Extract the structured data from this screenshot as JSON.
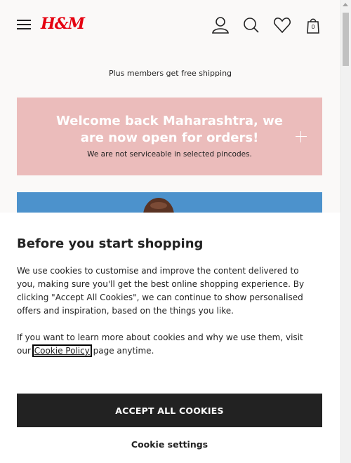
{
  "header": {
    "logo_text": "H&M",
    "cart_count": "0",
    "icons": [
      "menu-icon",
      "account-icon",
      "search-icon",
      "heart-icon",
      "bag-icon"
    ]
  },
  "promo": {
    "text": "Plus members get free shipping"
  },
  "banner": {
    "title": "Welcome back Maharashtra, we are now open for orders!",
    "subtitle": "We are not serviceable in selected pincodes.",
    "background": "#ebbcbb"
  },
  "cookie": {
    "title": "Before you start shopping",
    "paragraph1": "We use cookies to customise and improve the content delivered to you, making sure you'll get the best online shopping experience. By clicking \"Accept All Cookies\", we can continue to show personalised offers and inspiration, based on the things you like.",
    "paragraph2_prefix": "If you want to learn more about cookies and why we use them, visit our",
    "link_label": "Cookie Policy",
    "paragraph2_suffix": "page anytime.",
    "accept_label": "ACCEPT ALL COOKIES",
    "settings_label": "Cookie settings"
  },
  "colors": {
    "brand": "#e50010",
    "dark": "#222222",
    "hero_blue": "#4c92cc"
  }
}
